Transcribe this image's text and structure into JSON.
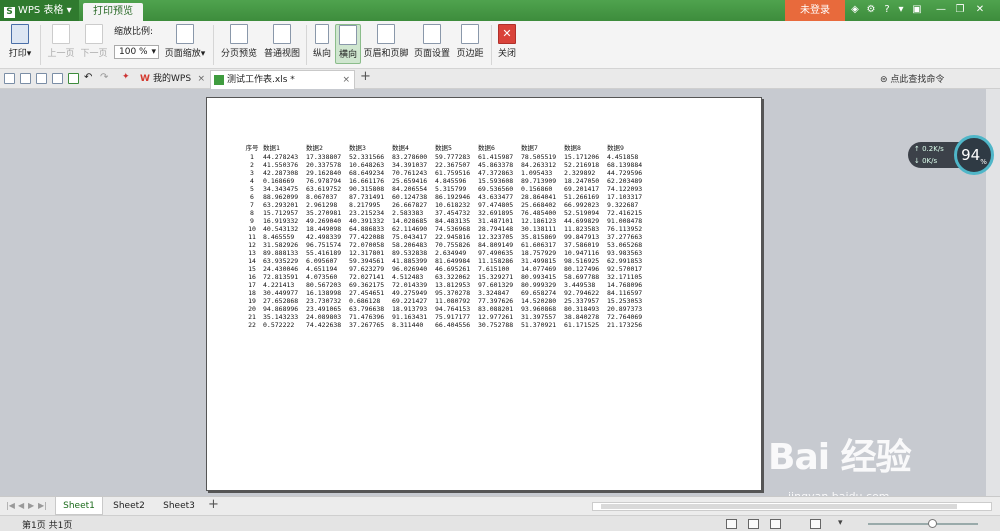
{
  "titlebar": {
    "app_name": "WPS 表格",
    "active_tab": "打印预览",
    "login": "未登录"
  },
  "ribbon": {
    "print": "打印",
    "prev_page": "上一页",
    "next_page": "下一页",
    "zoom_label": "缩放比例:",
    "zoom_value": "100 %",
    "page_zoom": "页面缩放",
    "page_break_preview": "分页预览",
    "normal_view": "普通视图",
    "portrait": "纵向",
    "landscape": "横向",
    "header_footer": "页眉和页脚",
    "page_setup": "页面设置",
    "margins": "页边距",
    "close": "关闭"
  },
  "tabs": {
    "wps": "我的WPS",
    "file": "测试工作表.xls *",
    "new": "+",
    "right_tools": "⊜ 点此查找命令"
  },
  "table": {
    "headers": [
      "序号",
      "数据1",
      "数据2",
      "数据3",
      "数据4",
      "数据5",
      "数据6",
      "数据7",
      "数据8",
      "数据9"
    ],
    "rows": [
      [
        "1",
        "44.278243",
        "17.338807",
        "52.331566",
        "83.278600",
        "59.777283",
        "61.415987",
        "78.505519",
        "15.171206",
        "4.451858"
      ],
      [
        "2",
        "41.550376",
        "20.337578",
        "10.648263",
        "34.391037",
        "22.367507",
        "45.863378",
        "84.263312",
        "52.216918",
        "68.139884"
      ],
      [
        "3",
        "42.287308",
        "29.162840",
        "68.649234",
        "70.761243",
        "61.759516",
        "47.372863",
        "1.095433",
        "2.329892",
        "44.729596"
      ],
      [
        "4",
        "0.168669",
        "76.978794",
        "16.661176",
        "25.659416",
        "4.845596",
        "15.593608",
        "89.713909",
        "18.247050",
        "62.203489"
      ],
      [
        "5",
        "34.343475",
        "63.619752",
        "90.315808",
        "84.206554",
        "5.315799",
        "69.536560",
        "0.156860",
        "69.201417",
        "74.122093"
      ],
      [
        "6",
        "88.962099",
        "8.067037",
        "87.731491",
        "60.124738",
        "86.192946",
        "43.633477",
        "28.864041",
        "51.266169",
        "17.103317"
      ],
      [
        "7",
        "63.293201",
        "2.961298",
        "8.217995",
        "26.667827",
        "10.618232",
        "97.474805",
        "25.668402",
        "66.992023",
        "9.322687"
      ],
      [
        "8",
        "15.712957",
        "35.270981",
        "23.215234",
        "2.583383",
        "37.454732",
        "32.691895",
        "76.485400",
        "52.519094",
        "72.416215"
      ],
      [
        "9",
        "16.919332",
        "49.269040",
        "40.391332",
        "14.028685",
        "84.483135",
        "31.487101",
        "12.186123",
        "44.699829",
        "91.008478"
      ],
      [
        "10",
        "40.543132",
        "18.449098",
        "64.886833",
        "62.114690",
        "74.536968",
        "28.794148",
        "30.138111",
        "11.823583",
        "76.113952"
      ],
      [
        "11",
        "8.465559",
        "42.498339",
        "77.422088",
        "75.043417",
        "22.945816",
        "12.323705",
        "35.815869",
        "99.847913",
        "37.277663"
      ],
      [
        "12",
        "31.582926",
        "96.751574",
        "72.070058",
        "58.206483",
        "70.755826",
        "84.809149",
        "61.606317",
        "37.586019",
        "53.065268"
      ],
      [
        "13",
        "89.888133",
        "55.416189",
        "12.317801",
        "89.532838",
        "2.634949",
        "97.490635",
        "18.757929",
        "10.947116",
        "93.983563"
      ],
      [
        "14",
        "63.935229",
        "6.095607",
        "59.394561",
        "41.885399",
        "81.649984",
        "11.158286",
        "31.499815",
        "98.516925",
        "62.991853"
      ],
      [
        "15",
        "24.430046",
        "4.651194",
        "97.623279",
        "96.026940",
        "46.695261",
        "7.615100",
        "14.077469",
        "80.127496",
        "92.570017"
      ],
      [
        "16",
        "72.813591",
        "4.073560",
        "72.027141",
        "4.512483",
        "63.322062",
        "15.329271",
        "80.993415",
        "58.697788",
        "32.171105"
      ],
      [
        "17",
        "4.221413",
        "80.567203",
        "69.362175",
        "72.014339",
        "13.812953",
        "97.601329",
        "80.999329",
        "3.449538",
        "14.768096"
      ],
      [
        "18",
        "30.449977",
        "16.138998",
        "27.454651",
        "49.275949",
        "95.370278",
        "3.324847",
        "69.658274",
        "92.794622",
        "84.116597"
      ],
      [
        "19",
        "27.652868",
        "23.730732",
        "0.686128",
        "69.221427",
        "11.080792",
        "77.397626",
        "14.520280",
        "25.337957",
        "15.253053"
      ],
      [
        "20",
        "94.868996",
        "23.491065",
        "63.796638",
        "18.913793",
        "94.764153",
        "83.088201",
        "93.960868",
        "80.318493",
        "20.897373"
      ],
      [
        "21",
        "35.143233",
        "24.089803",
        "71.476396",
        "91.163431",
        "75.917177",
        "12.977261",
        "31.397557",
        "38.840278",
        "72.764069"
      ],
      [
        "22",
        "0.572222",
        "74.422638",
        "37.267765",
        "8.311440",
        "66.404556",
        "30.752788",
        "51.370921",
        "61.171525",
        "21.173256"
      ]
    ]
  },
  "speed": {
    "up": "↑ 0.2K/s",
    "down": "↓ 0K/s",
    "percent": "94",
    "unit": "%"
  },
  "sheets": [
    "Sheet1",
    "Sheet2",
    "Sheet3"
  ],
  "status": {
    "page_info": "第1页 共1页"
  },
  "watermark": {
    "brand": "Bai  经验",
    "sub": "jingyan.baidu.com"
  },
  "colors": {
    "green": "#3d8c3c",
    "login": "#e86a3c"
  }
}
